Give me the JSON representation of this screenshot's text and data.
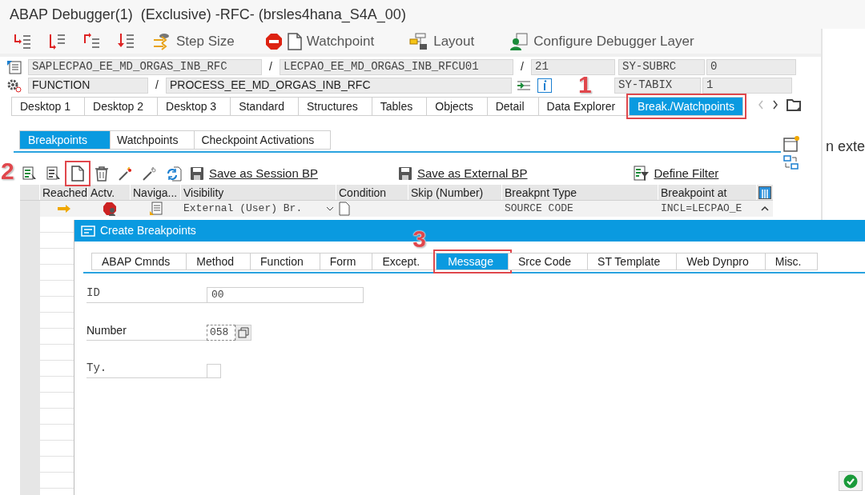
{
  "window": {
    "title": "ABAP Debugger(1)  (Exclusive) -RFC- (brsles4hana_S4A_00)"
  },
  "toolbar": [
    {
      "kind": "single-step"
    },
    {
      "kind": "execute"
    },
    {
      "kind": "return"
    },
    {
      "kind": "continue"
    },
    {
      "kind": "step-size",
      "label": "Step Size"
    },
    {
      "kind": "watchpoint",
      "label": "Watchpoint"
    },
    {
      "kind": "layout",
      "label": "Layout"
    },
    {
      "kind": "configure",
      "label": "Configure Debugger Layer"
    }
  ],
  "program_info": {
    "separators": [
      "/",
      "/",
      "/"
    ],
    "program": "SAPLECPAO_EE_MD_ORGAS_INB_RFC",
    "include": "LECPAO_EE_MD_ORGAS_INB_RFCU01",
    "line": "21",
    "event_type": "FUNCTION",
    "event": "PROCESS_EE_MD_ORGAS_INB_RFC",
    "system_fields": [
      {
        "name": "SY-SUBRC",
        "value": "0"
      },
      {
        "name": "SY-TABIX",
        "value": "1"
      }
    ]
  },
  "tabs": [
    {
      "label": "Desktop 1",
      "selected": false
    },
    {
      "label": "Desktop 2",
      "selected": false
    },
    {
      "label": "Desktop 3",
      "selected": false
    },
    {
      "label": "Standard",
      "selected": false
    },
    {
      "label": "Structures",
      "selected": false
    },
    {
      "label": "Tables",
      "selected": false
    },
    {
      "label": "Objects",
      "selected": false
    },
    {
      "label": "Detail",
      "selected": false
    },
    {
      "label": "Data Explorer",
      "selected": false
    },
    {
      "label": "Break./Watchpoints",
      "selected": true,
      "callout": "1"
    }
  ],
  "breakpoint_tabs": [
    {
      "label": "Breakpoints",
      "selected": true
    },
    {
      "label": "Watchpoints",
      "selected": false
    },
    {
      "label": "Checkpoint Activations",
      "selected": false
    }
  ],
  "breakpoint_toolbar": {
    "icons": [
      {
        "kind": "display"
      },
      {
        "kind": "change"
      },
      {
        "kind": "create",
        "callout": "2"
      },
      {
        "kind": "delete"
      },
      {
        "kind": "activate"
      },
      {
        "kind": "deactivate"
      },
      {
        "kind": "refresh"
      }
    ],
    "links": [
      {
        "kind": "save",
        "label": "Save as Session BP"
      },
      {
        "kind": "save",
        "label": "Save as External BP"
      },
      {
        "kind": "filter",
        "label": "Define Filter"
      }
    ]
  },
  "table": {
    "columns": [
      "Reached",
      "Actv.",
      "Naviga...",
      "Visibility",
      "Condition",
      "Skip (Number)",
      "Breakpnt Type",
      "Breakpoint at"
    ],
    "rows": [
      {
        "reached": true,
        "visibility": "External (User) Br.",
        "breakpoint_type": "SOURCE CODE",
        "breakpoint_at": "INCL=LECPAO_E"
      }
    ]
  },
  "side_text": "n exte",
  "dialog": {
    "title": "Create Breakpoints",
    "tabs": [
      {
        "label": "ABAP Cmnds",
        "selected": false
      },
      {
        "label": "Method",
        "selected": false
      },
      {
        "label": "Function",
        "selected": false
      },
      {
        "label": "Form",
        "selected": false
      },
      {
        "label": "Except.",
        "selected": false
      },
      {
        "label": "Message",
        "selected": true,
        "callout": "3"
      },
      {
        "label": "Srce Code",
        "selected": false
      },
      {
        "label": "ST Template",
        "selected": false
      },
      {
        "label": "Web Dynpro",
        "selected": false
      },
      {
        "label": "Misc."
      }
    ],
    "fields": [
      {
        "kind": "plain",
        "label": "ID",
        "value": "00"
      },
      {
        "kind": "value-help",
        "label": "Number",
        "value": "058"
      },
      {
        "kind": "checkbox",
        "label": "Ty."
      }
    ]
  }
}
